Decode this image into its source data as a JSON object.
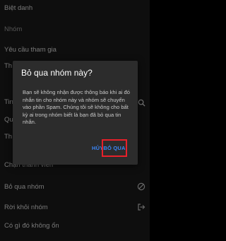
{
  "settings_list": {
    "items": [
      {
        "label": "Biệt danh"
      },
      {
        "label": "Nhóm"
      },
      {
        "label": "Yêu cầu tham gia"
      },
      {
        "label": "Th"
      },
      {
        "label": "Tin"
      },
      {
        "label": "Qu"
      },
      {
        "label": "Th"
      },
      {
        "label": "Chặn thành viên"
      },
      {
        "label": "Bỏ qua nhóm"
      },
      {
        "label": "Rời khỏi nhóm"
      },
      {
        "label": "Có gì đó không ổn"
      }
    ]
  },
  "dialog": {
    "title": "Bỏ qua nhóm này?",
    "body": "Bạn sẽ không nhận được thông báo khi ai đó nhắn tin cho nhóm này và nhóm sẽ chuyển vào phần Spam. Chúng tôi sẽ không cho bất kỳ ai trong nhóm biết là bạn đã bỏ qua tin nhắn.",
    "cancel_label": "HỦY",
    "confirm_label": "BỎ QUA"
  },
  "colors": {
    "background": "#1b1b1b",
    "dialog_background": "#2c2c2c",
    "accent": "#3b86f7",
    "highlight_box": "#e8202a"
  },
  "icons": {
    "ignore_group": "no-entry-icon",
    "leave_group": "exit-icon",
    "search": "search-icon"
  }
}
